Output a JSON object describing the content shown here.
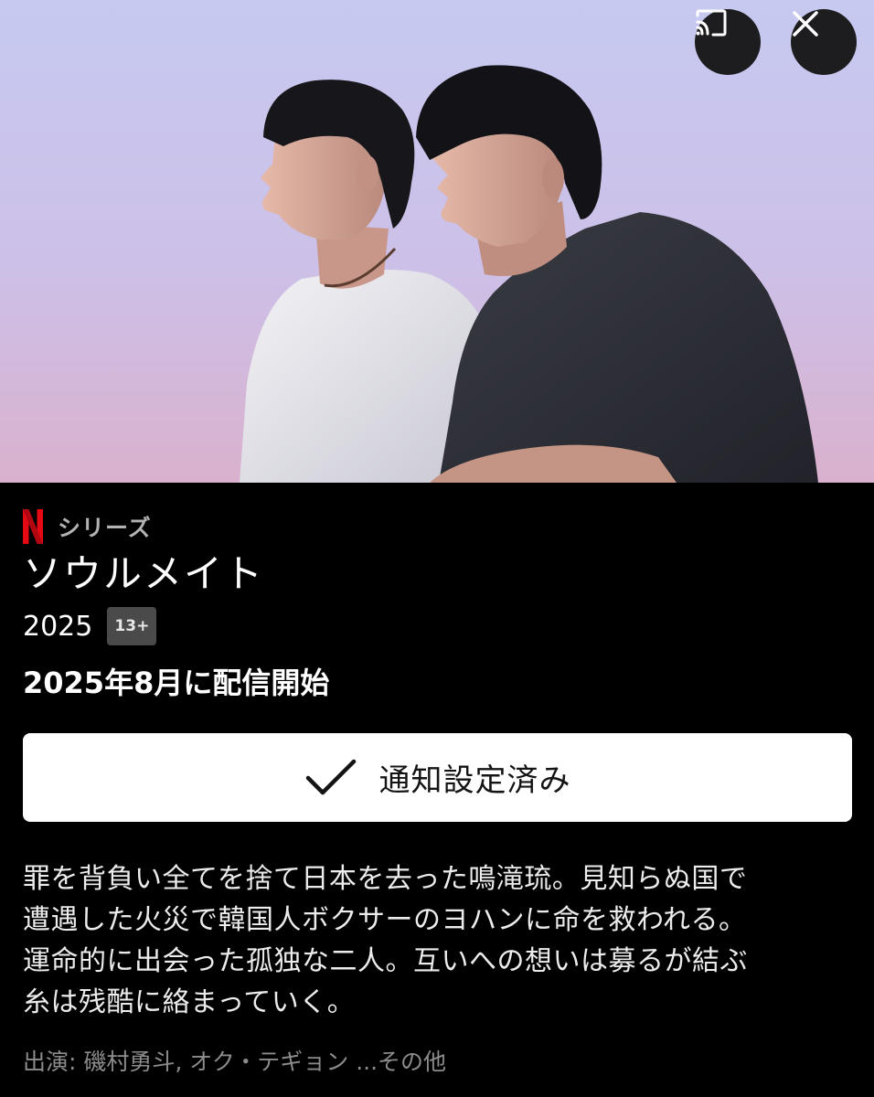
{
  "header": {
    "cast_icon": "cast-icon",
    "close_icon": "close-icon"
  },
  "hero": {
    "image": "poster-two-young-men-looking-up-at-dusk-sky"
  },
  "brand": {
    "logo_letter": "N",
    "logo_color": "#e50914",
    "label": "シリーズ"
  },
  "title": "ソウルメイト",
  "meta": {
    "year": "2025",
    "rating": "13+"
  },
  "release_text": "2025年8月に配信開始",
  "notify_button": {
    "icon": "check-icon",
    "label": "通知設定済み"
  },
  "synopsis_lines": [
    "罪を背負い全てを捨て日本を去った鳴滝琉。見知らぬ国で",
    "遭遇した火災で韓国人ボクサーのヨハンに命を救われる。",
    "運命的に出会った孤独な二人。互いへの想いは募るが結ぶ",
    "糸は残酷に絡まっていく。"
  ],
  "cast_text": "出演: 磯村勇斗, オク・テギョン ...その他",
  "colors": {
    "background": "#000000",
    "button_bg": "#ffffff",
    "rating_bg": "#4a4a4a",
    "netflix_red": "#e50914"
  }
}
